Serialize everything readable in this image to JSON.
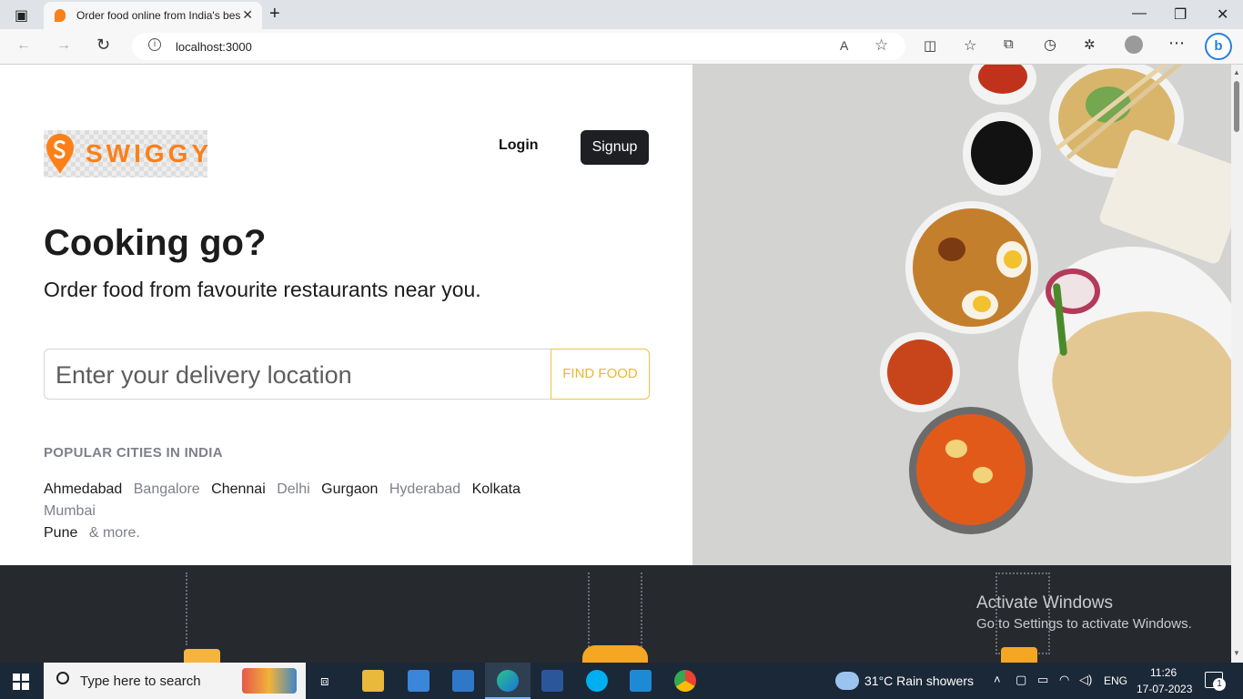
{
  "browser": {
    "tab_title": "Order food online from India's best",
    "tab_close": "✕",
    "new_tab": "+",
    "url": "localhost:3000",
    "window_controls": {
      "minimize": "—",
      "maximize": "❐",
      "close": "✕"
    }
  },
  "header": {
    "logo_text": "SWIGGY",
    "login_label": "Login",
    "signup_label": "Signup"
  },
  "hero": {
    "headline": "Cooking go?",
    "subline": "Order food from favourite restaurants near you."
  },
  "search": {
    "placeholder": "Enter your delivery location",
    "button_label": "FIND FOOD"
  },
  "cities": {
    "heading": "POPULAR CITIES IN INDIA",
    "items": [
      "Ahmedabad",
      "Bangalore",
      "Chennai",
      "Delhi",
      "Gurgaon",
      "Hyderabad",
      "Kolkata",
      "Mumbai",
      "Pune"
    ],
    "more": "& more."
  },
  "watermark": {
    "title": "Activate Windows",
    "subtitle": "Go to Settings to activate Windows."
  },
  "taskbar": {
    "search_placeholder": "Type here to search",
    "weather": "31°C  Rain showers",
    "language": "ENG",
    "time": "11:26",
    "date": "17-07-2023",
    "notifications": "1"
  },
  "colors": {
    "brand_orange": "#fc8019",
    "find_food_yellow": "#e8b92f",
    "dark_button": "#1d1f22",
    "footer_band": "#262a2f"
  }
}
